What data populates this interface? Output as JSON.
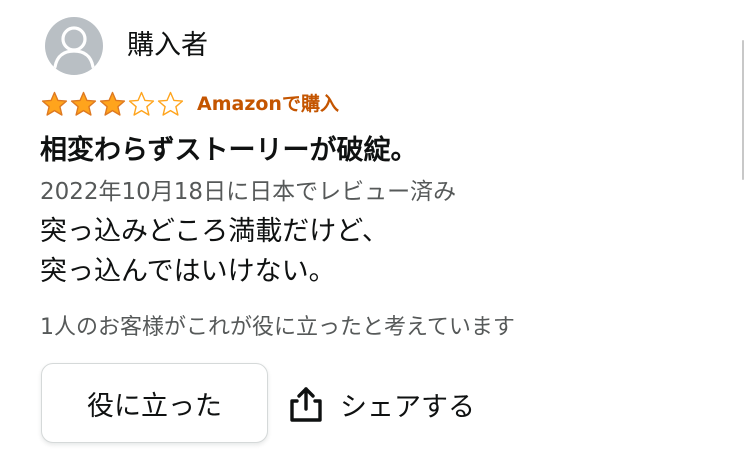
{
  "reviewer": {
    "name": "購入者",
    "avatar_icon": "default-user-avatar-icon"
  },
  "rating": {
    "stars": 3,
    "max": 5,
    "star_color": "#ffa41c",
    "badge": "Amazonで購入",
    "badge_color": "#c45500"
  },
  "review": {
    "title": "相変わらずストーリーが破綻。",
    "date": "2022年10月18日に日本でレビュー済み",
    "body_lines": [
      "突っ込みどころ満載だけど、",
      "突っ込んではいけない。"
    ]
  },
  "helpful": {
    "count_text": "1人のお客様がこれが役に立ったと考えています",
    "button_label": "役に立った"
  },
  "share": {
    "label": "シェアする",
    "icon": "share-icon"
  }
}
